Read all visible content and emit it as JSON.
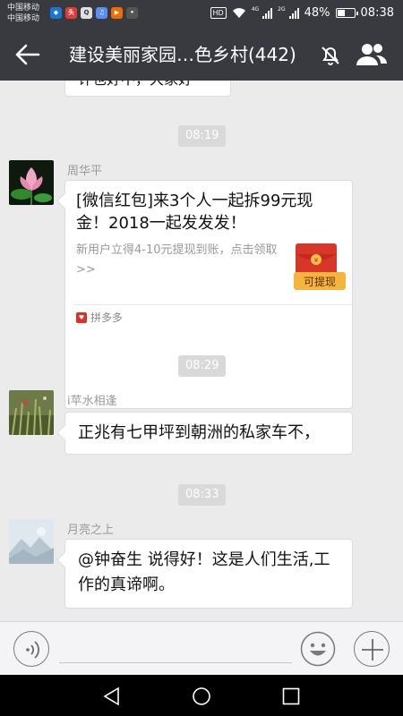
{
  "status_bar": {
    "carrier_1": "中国移动",
    "carrier_2": "中国移动",
    "app_icons": [
      "weibo-icon",
      "toutiao-icon",
      "uc-icon",
      "music-icon",
      "video-icon",
      "kuaishou-icon"
    ],
    "hd_label": "HD",
    "net_tag_1": "4G",
    "net_tag_2": "2G",
    "battery": "48%",
    "battery_level": 0.48,
    "time": "08:38"
  },
  "title_bar": {
    "title": "建设美丽家园…色乡村(442)"
  },
  "chat": {
    "top_partial_message": "许也好不，大家好",
    "messages": [
      {
        "time": "08:19",
        "sender": "周华平",
        "card": {
          "title": "[微信红包]来3个人一起拆99元现金！2018一起发发发！",
          "description": "新用户立得4-10元提现到账，点击领取>>",
          "redpack_label": "可提现",
          "source": "拼多多"
        }
      },
      {
        "time": "08:29",
        "sender": "i苹水相逢",
        "text": "正兆有七甲坪到朝洲的私家车不，"
      },
      {
        "time": "08:33",
        "sender": "月亮之上",
        "text": "@钟奋生  说得好！这是人们生活,工作的真谛啊。"
      }
    ]
  },
  "input_bar": {
    "placeholder": ""
  },
  "colors": {
    "header": "#393a3f",
    "chat_bg": "#ebebeb",
    "bubble": "#ffffff",
    "redpack": "#d9362a",
    "redpack_label_bg": "#f5b43c"
  }
}
